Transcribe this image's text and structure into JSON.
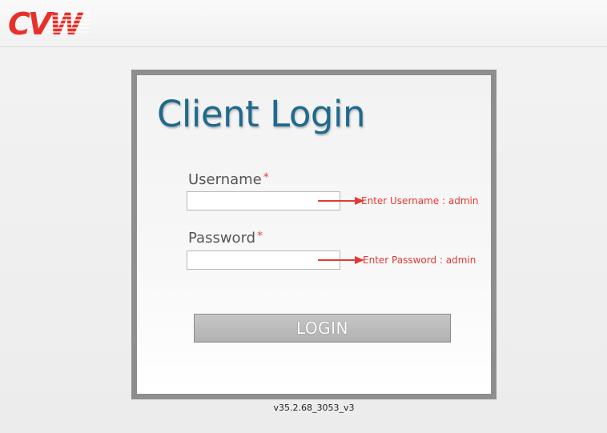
{
  "brand": {
    "logo_text": "CVW",
    "logo_color": "#e8302a"
  },
  "login": {
    "title": "Client Login",
    "username_label": "Username",
    "password_label": "Password",
    "required_marker": "*",
    "username_value": "",
    "password_value": "",
    "username_hint": "Enter Username : admin",
    "password_hint": "Enter Password : admin",
    "submit_label": "LOGIN"
  },
  "footer": {
    "version": "v35.2.68_3053_v3"
  },
  "colors": {
    "title": "#1f6a8c",
    "required": "#e0443c",
    "hint": "#e33b33",
    "button": "#b8b8b8",
    "frame": "#8e8e8e"
  }
}
